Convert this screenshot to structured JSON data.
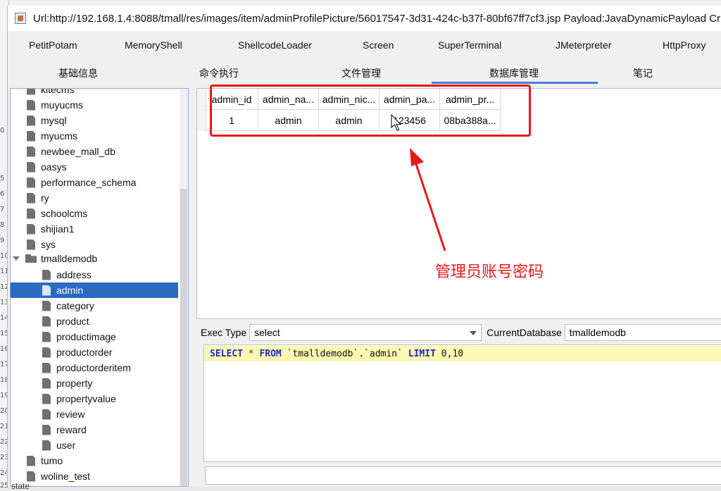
{
  "background_strip": {
    "numbers": [
      "0",
      "5",
      "6",
      "7",
      "8",
      "9",
      "10",
      "11",
      "12",
      "13",
      "14",
      "15",
      "16",
      "17",
      "18",
      "19",
      "20",
      "21",
      "22",
      "23",
      "24",
      "25"
    ]
  },
  "window": {
    "title": "Url:http://192.168.1.4:8088/tmall/res/images/item/adminProfilePicture/56017547-3d31-424c-b37f-80bf67ff7cf3.jsp Payload:JavaDynamicPayload Cr"
  },
  "plugins": [
    "PetitPotam",
    "MemoryShell",
    "ShellcodeLoader",
    "Screen",
    "SuperTerminal",
    "JMeterpreter",
    "HttpProxy"
  ],
  "tabs": [
    "基础信息",
    "命令执行",
    "文件管理",
    "数据库管理",
    "笔记"
  ],
  "active_tab": "数据库管理",
  "tree": {
    "items": [
      {
        "label": "kitecms",
        "type": "db"
      },
      {
        "label": "muyucms",
        "type": "db"
      },
      {
        "label": "mysql",
        "type": "db"
      },
      {
        "label": "myucms",
        "type": "db"
      },
      {
        "label": "newbee_mall_db",
        "type": "db"
      },
      {
        "label": "oasys",
        "type": "db"
      },
      {
        "label": "performance_schema",
        "type": "db"
      },
      {
        "label": "ry",
        "type": "db"
      },
      {
        "label": "schoolcms",
        "type": "db"
      },
      {
        "label": "shijian1",
        "type": "db"
      },
      {
        "label": "sys",
        "type": "db"
      },
      {
        "label": "tmalldemodb",
        "type": "folder"
      },
      {
        "label": "address",
        "type": "table"
      },
      {
        "label": "admin",
        "type": "table",
        "selected": true
      },
      {
        "label": "category",
        "type": "table"
      },
      {
        "label": "product",
        "type": "table"
      },
      {
        "label": "productimage",
        "type": "table"
      },
      {
        "label": "productorder",
        "type": "table"
      },
      {
        "label": "productorderitem",
        "type": "table"
      },
      {
        "label": "property",
        "type": "table"
      },
      {
        "label": "propertyvalue",
        "type": "table"
      },
      {
        "label": "review",
        "type": "table"
      },
      {
        "label": "reward",
        "type": "table"
      },
      {
        "label": "user",
        "type": "table"
      },
      {
        "label": "tumo",
        "type": "db"
      },
      {
        "label": "woline_test",
        "type": "db"
      }
    ]
  },
  "grid": {
    "columns": [
      "admin_id",
      "admin_na...",
      "admin_nic...",
      "admin_pa...",
      "admin_pr..."
    ],
    "rows": [
      [
        "1",
        "admin",
        "admin",
        "123456",
        "08ba388a..."
      ]
    ]
  },
  "annotation": {
    "text": "管理员账号密码",
    "color": "#e8181a"
  },
  "exec": {
    "label": "Exec Type",
    "value": "select",
    "current_db_label": "CurrentDatabase",
    "current_db_value": "tmalldemodb"
  },
  "sql": {
    "kw_select": "SELECT",
    "star": " * ",
    "kw_from": "FROM",
    "target": " `tmalldemodb`.`admin` ",
    "kw_limit": "LIMIT",
    "limit_value": " 0,10"
  },
  "status": {
    "text": "state"
  },
  "colors": {
    "selection": "#2a6bc0",
    "tab_underline": "#4a7bd0",
    "sql_highlight": "#fdf8b4",
    "sql_keyword": "#1a2cc8"
  }
}
